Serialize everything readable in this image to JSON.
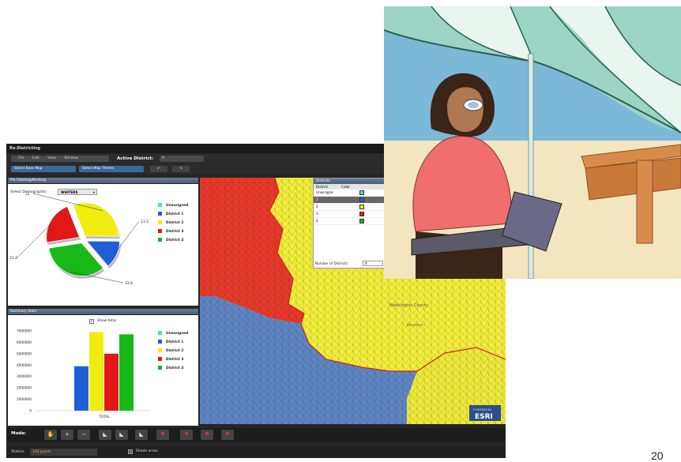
{
  "app": {
    "title": "Re-Districting"
  },
  "menu": {
    "items": [
      "File",
      "Edit",
      "View",
      "Window"
    ],
    "active_district_label": "Active District:",
    "active_district_value": "0"
  },
  "toolbar": {
    "base_map": "Select Base Map",
    "map_theme": "Select Map Theme",
    "undo": "↶",
    "redo": "↷"
  },
  "pie_panel": {
    "title": "Pie Charting/Marking",
    "demographic_label": "Select Demographic:",
    "demographic_value": "WHITERS"
  },
  "bar_panel": {
    "title": "Summary Stats",
    "show_total_label": "Show total"
  },
  "legend": [
    {
      "label": "Unassigned",
      "color": "#3fe0e8"
    },
    {
      "label": "District 1",
      "color": "#1e5fd8"
    },
    {
      "label": "District 2",
      "color": "#f0ec10"
    },
    {
      "label": "District 3",
      "color": "#e01818"
    },
    {
      "label": "District 4",
      "color": "#18b818"
    }
  ],
  "chart_data": [
    {
      "type": "pie",
      "categories": [
        "District 2",
        "District 1",
        "District 4",
        "District 3"
      ],
      "values": [
        31,
        13.5,
        33.6,
        21.4
      ],
      "labels": [
        "31",
        "13.5",
        "33.6",
        "21.4"
      ],
      "colors": [
        "#f0ec10",
        "#1e5fd8",
        "#18b818",
        "#e01818"
      ]
    },
    {
      "type": "bar",
      "categories": [
        "District 1",
        "District 2",
        "District 3",
        "District 4"
      ],
      "values": [
        3900000,
        6900000,
        5000000,
        6700000
      ],
      "colors": [
        "#1e5fd8",
        "#f0ec10",
        "#e01818",
        "#18b818"
      ],
      "yticks": [
        "7000000",
        "6000000",
        "5000000",
        "4000000",
        "3000000",
        "2000000",
        "1000000",
        "0"
      ],
      "ylim": [
        0,
        7000000
      ],
      "xlabel": "TOTAL"
    }
  ],
  "districts_table": {
    "title": "Districts",
    "headers": [
      "District",
      "Color"
    ],
    "rows": [
      {
        "name": "Unassigne",
        "color": "#3fe0e8"
      },
      {
        "name": "1",
        "color": "#1e5fd8"
      },
      {
        "name": "2",
        "color": "#f0ec10"
      },
      {
        "name": "3",
        "color": "#e01818"
      },
      {
        "name": "4",
        "color": "#18b818"
      }
    ],
    "num_label": "Number of Districts:",
    "num_value": "4"
  },
  "map": {
    "county_label": "Washington County",
    "town_label": "Brenham",
    "logo_top": "POWERED BY",
    "logo": "ESRI"
  },
  "mode_bar": {
    "label": "Mode:",
    "buttons": [
      "✋",
      "+",
      "−",
      "◣",
      "◣",
      "◣",
      "⚑",
      "⚑",
      "⚑",
      "⚑"
    ]
  },
  "status": {
    "label": "Status:",
    "value": "104 points",
    "shade_label": "Shade areas"
  },
  "page_number": "20"
}
